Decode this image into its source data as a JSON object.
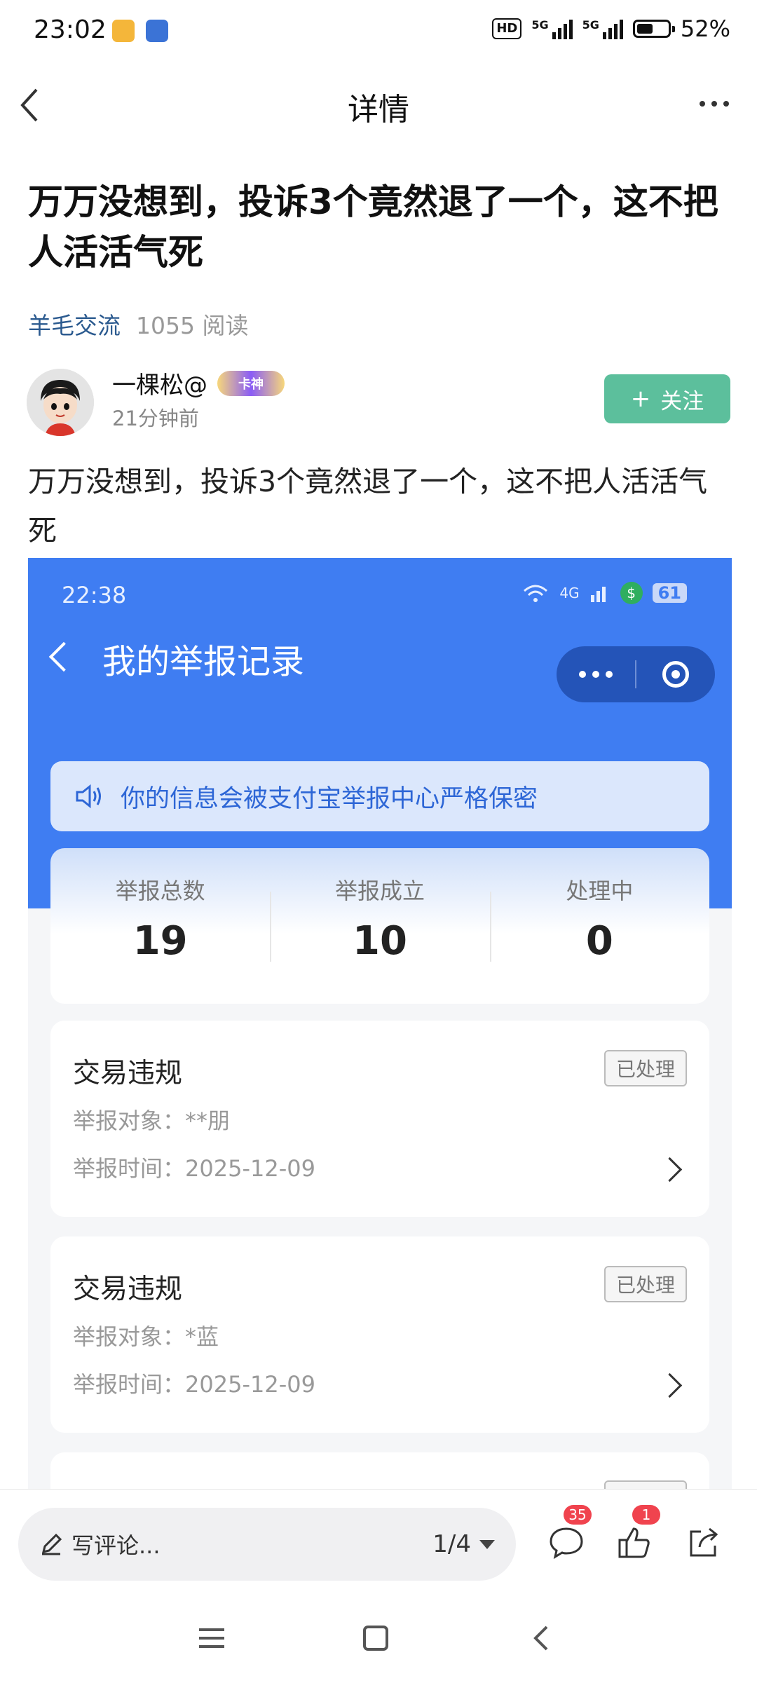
{
  "status_bar": {
    "time": "23:02",
    "hd": "HD",
    "net1": "5G",
    "net2": "5G",
    "battery": "52%",
    "battery_level": 0.52
  },
  "nav": {
    "title": "详情"
  },
  "article": {
    "title": "万万没想到，投诉3个竟然退了一个，这不把人活活气死",
    "category": "羊毛交流",
    "reads": "1055 阅读",
    "author": "一棵松@",
    "author_badge": "卡神",
    "post_time": "21分钟前",
    "follow_label": "关注",
    "body": "万万没想到，投诉3个竟然退了一个，这不把人活活气死"
  },
  "screenshot": {
    "time": "22:38",
    "network": "4G",
    "battery": "61",
    "title": "我的举报记录",
    "notice": "你的信息会被支付宝举报中心严格保密",
    "stats": [
      {
        "label": "举报总数",
        "value": "19"
      },
      {
        "label": "举报成立",
        "value": "10"
      },
      {
        "label": "处理中",
        "value": "0"
      }
    ],
    "records": [
      {
        "type": "交易违规",
        "status": "已处理",
        "target_label": "举报对象：",
        "target": "**朋",
        "time_label": "举报时间：",
        "time": "2025-12-09"
      },
      {
        "type": "交易违规",
        "status": "已处理",
        "target_label": "举报对象：",
        "target": "*蓝",
        "time_label": "举报时间：",
        "time": "2025-12-09"
      }
    ]
  },
  "bottom_bar": {
    "comment_placeholder": "写评论...",
    "page_indicator": "1/4",
    "comment_count": "35",
    "like_count": "1"
  },
  "colors": {
    "accent_blue": "#3f7df2",
    "follow_green": "#5cbf9c",
    "badge_red": "#f0434e",
    "category_blue": "#2b5a8f"
  }
}
